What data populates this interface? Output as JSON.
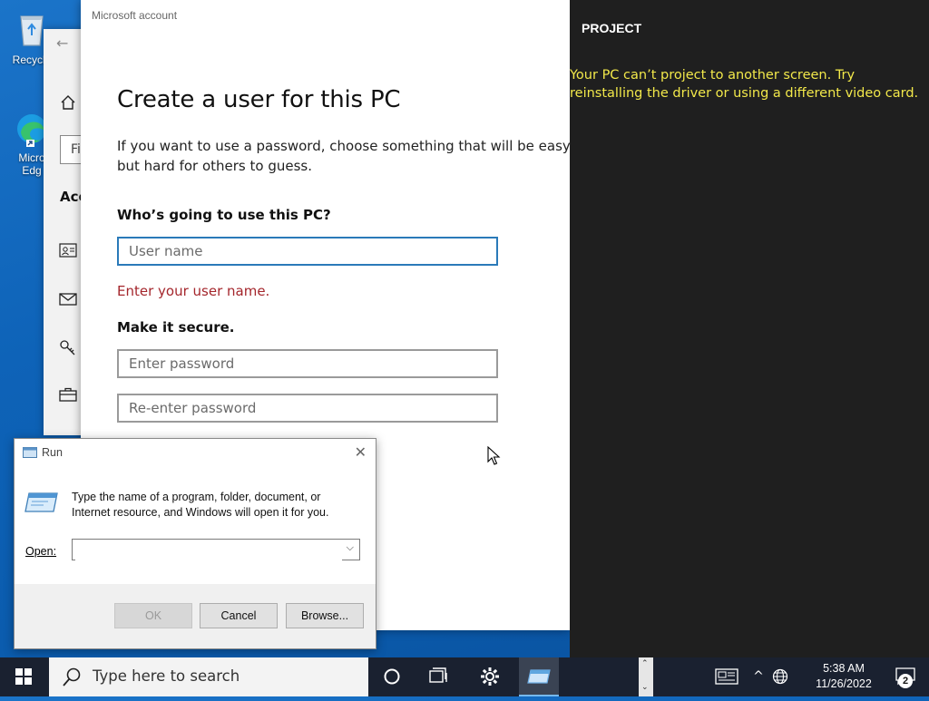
{
  "desktop": {
    "icons": [
      {
        "name": "recycle-bin",
        "label": "Recycle"
      },
      {
        "name": "microsoft-edge",
        "label_line1": "Micro",
        "label_line2": "Edg"
      }
    ]
  },
  "settings_window": {
    "partial_search_text": "Fi",
    "partial_heading": "Acc",
    "nav_icons": [
      "home-icon",
      "user-info-icon",
      "mail-icon",
      "key-icon",
      "briefcase-icon"
    ]
  },
  "ms_account": {
    "window_title": "Microsoft account",
    "heading": "Create a user for this PC",
    "intro_line1": "If you want to use a password, choose something that will be easy for",
    "intro_line2": "but hard for others to guess.",
    "who_label": "Who’s going to use this PC?",
    "username_placeholder": "User name",
    "username_value": "",
    "error_text": "Enter your user name.",
    "secure_label": "Make it secure.",
    "password_placeholder": "Enter password",
    "reenter_placeholder": "Re-enter password"
  },
  "project_panel": {
    "title": "PROJECT",
    "message": "Your PC can’t project to another screen. Try reinstalling the driver or using a different video card."
  },
  "run_dialog": {
    "title": "Run",
    "description": "Type the name of a program, folder, document, or Internet resource, and Windows will open it for you.",
    "open_label": "Open:",
    "open_value": "",
    "ok_label": "OK",
    "cancel_label": "Cancel",
    "browse_label": "Browse..."
  },
  "taskbar": {
    "search_placeholder": "Type here to search",
    "time": "5:38 AM",
    "date": "11/26/2022",
    "notification_count": "2"
  }
}
